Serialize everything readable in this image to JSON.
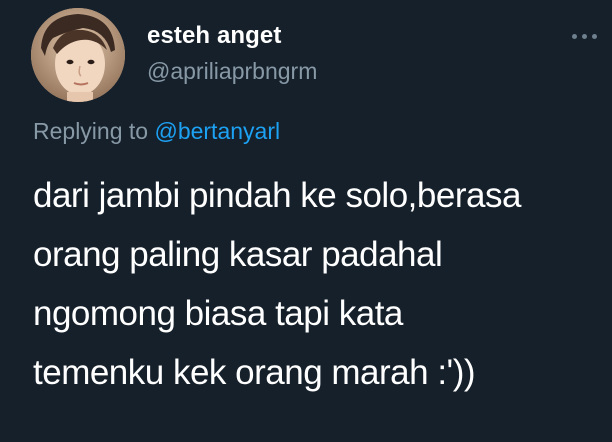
{
  "tweet": {
    "author": {
      "display_name": "esteh anget",
      "handle": "@apriliaprbngrm"
    },
    "reply": {
      "prefix": "Replying to",
      "mention": "@bertanyarl"
    },
    "text": "dari jambi pindah ke solo,berasa\norang paling kasar padahal\nngomong biasa tapi kata\ntemenku kek orang marah :'))"
  },
  "colors": {
    "background": "#15202b",
    "primary_text": "#ffffff",
    "secondary_text": "#8899a6",
    "accent": "#1da1f2"
  },
  "icons": {
    "more": "more-horizontal-icon"
  }
}
